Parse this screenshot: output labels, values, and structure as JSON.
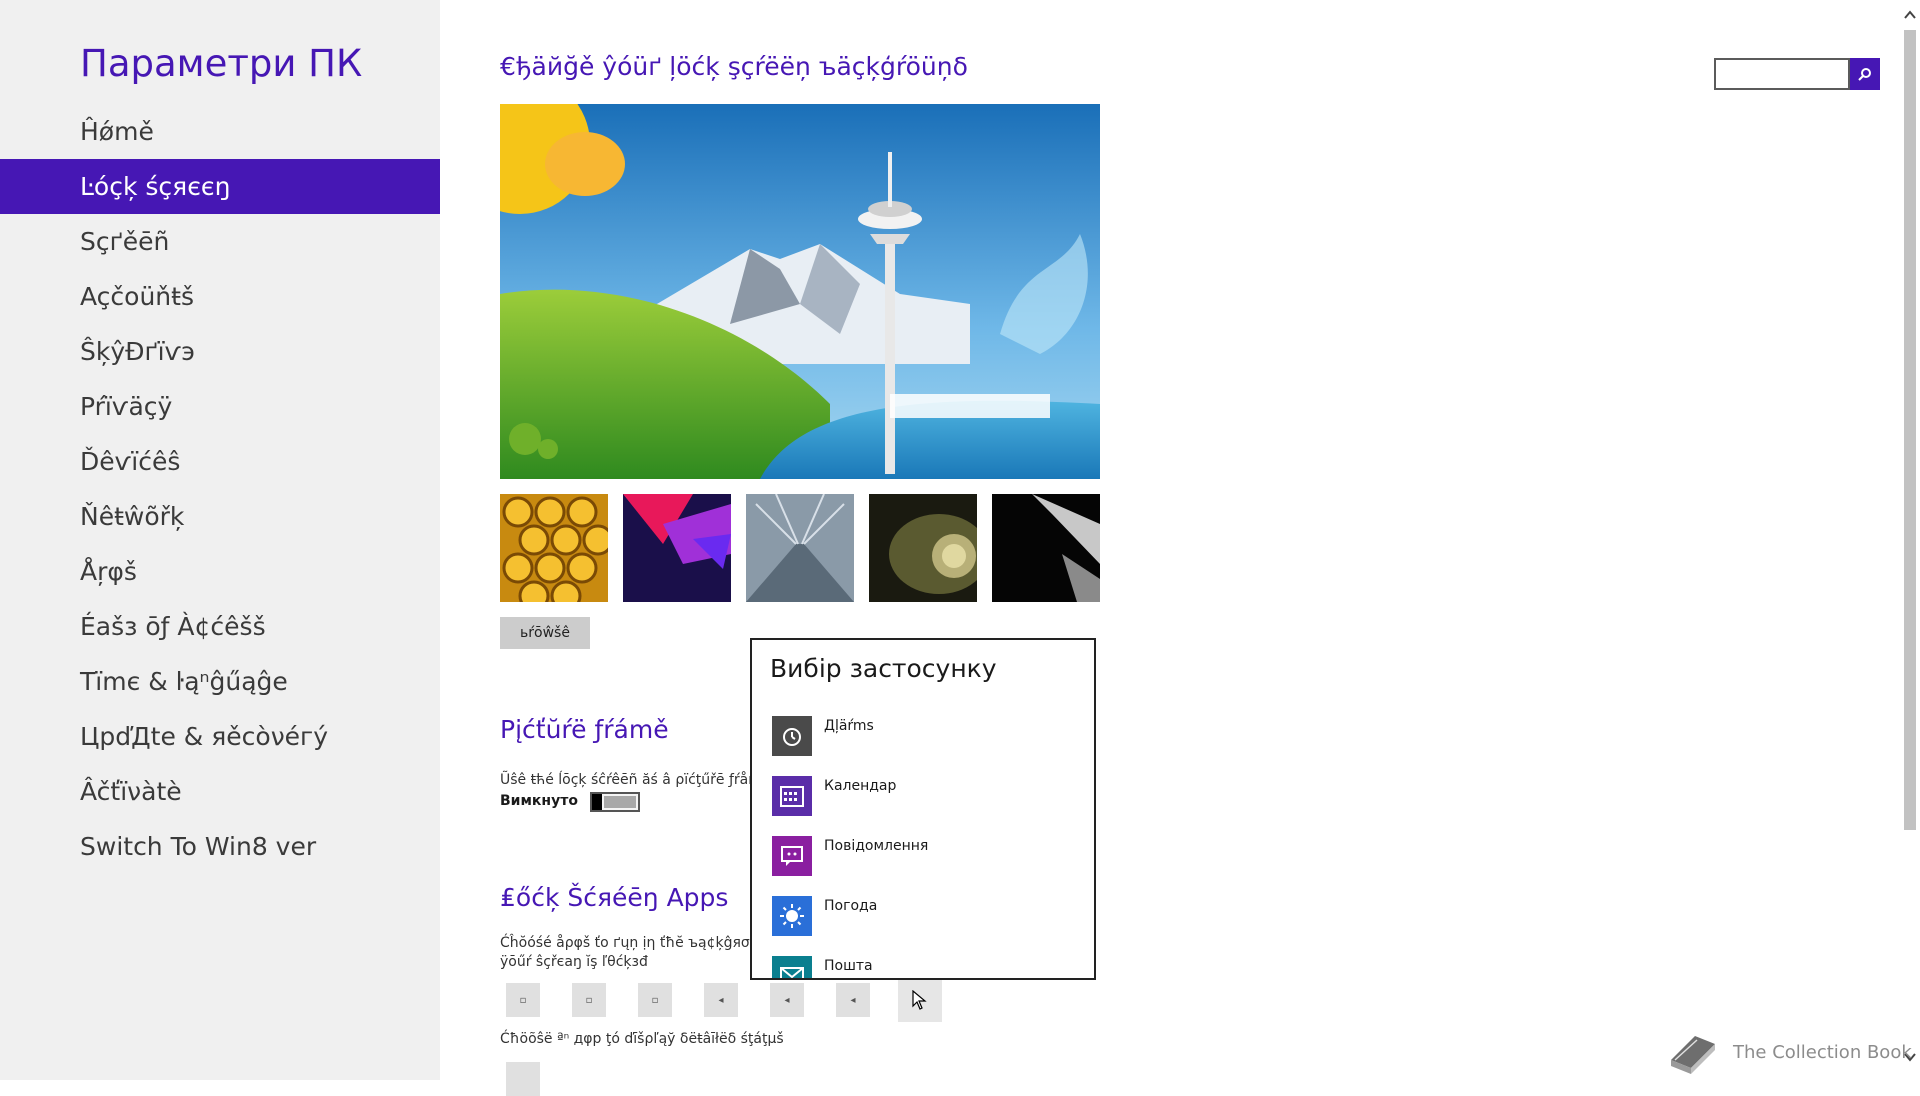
{
  "sidebar": {
    "title": "Параметри ПК",
    "items": [
      {
        "label": "Ĥǿmě",
        "active": false
      },
      {
        "label": "Ŀóçķ śçяєєŋ",
        "active": true
      },
      {
        "label": "Sçґěēñ",
        "active": false
      },
      {
        "label": "Açčoüňŧš",
        "active": false
      },
      {
        "label": "ŜķŷĐґïѵэ",
        "active": false
      },
      {
        "label": "Pŕïѵäçÿ",
        "active": false
      },
      {
        "label": "Ďêѵïćêŝ",
        "active": false
      },
      {
        "label": "Ňêŧŵõřķ",
        "active": false
      },
      {
        "label": "Åŗφš",
        "active": false
      },
      {
        "label": "Éašз ōƒ À¢ćêšš",
        "active": false
      },
      {
        "label": "Tïmє & ŀąⁿĝűąĝе",
        "active": false
      },
      {
        "label": "ЦpďДtе & яěсòνéгý",
        "active": false
      },
      {
        "label": "Âčťïνàtè",
        "active": false
      },
      {
        "label": "Switch To Win8 ver",
        "active": false
      }
    ]
  },
  "main": {
    "background_section": {
      "title": "€ђäйğě ŷóüґ ļöćķ şçŕëëņ ъäçķģŕöüņδ",
      "browse_label": "ьŕōŵšê"
    },
    "frame_section": {
      "title": "Pįćťŭŕë ƒŕámě",
      "description": "Ũŝê ŧћé ĺōçķ śĉŕêēñ ăś â ρïćţűřē ƒŕåmě",
      "toggle_state": "Вимкнуто",
      "toggle_on": false
    },
    "apps_section": {
      "title": "₤őćķ Šćяéēŋ Apps",
      "description_line1": "Ćĥŏóśé åρφš ťо ґųņ ịη ťħĕ ъą¢ķĝяσџňð",
      "description_line2": "ÿōűŕ ŝçřєaŋ ĭş ľθćķзđ",
      "status_description": "Ćħöõŝë ªⁿ дφр ţό ďīšρľąў δёŧâīłёδ śţáţµš",
      "slots": [
        "▫",
        "▫",
        "▫",
        "◂",
        "◂",
        "◂",
        ""
      ]
    }
  },
  "popup": {
    "title": "Вибір застосунку",
    "items": [
      {
        "label": "Дļäŕms",
        "icon": "alarm-clock-icon",
        "color": "#4a4a4a"
      },
      {
        "label": "Календар",
        "icon": "calendar-icon",
        "color": "#5a2da8"
      },
      {
        "label": "Повідомлення",
        "icon": "messaging-icon",
        "color": "#8a1fa0"
      },
      {
        "label": "Погода",
        "icon": "weather-sun-icon",
        "color": "#2a6fd8"
      },
      {
        "label": "Пошта",
        "icon": "mail-icon",
        "color": "#0a7f8f"
      }
    ]
  },
  "search": {
    "placeholder": "",
    "value": ""
  },
  "watermark": {
    "text": "The Collection Book"
  },
  "colors": {
    "accent": "#4617b4",
    "sidebar_bg": "#f0f0f0"
  }
}
